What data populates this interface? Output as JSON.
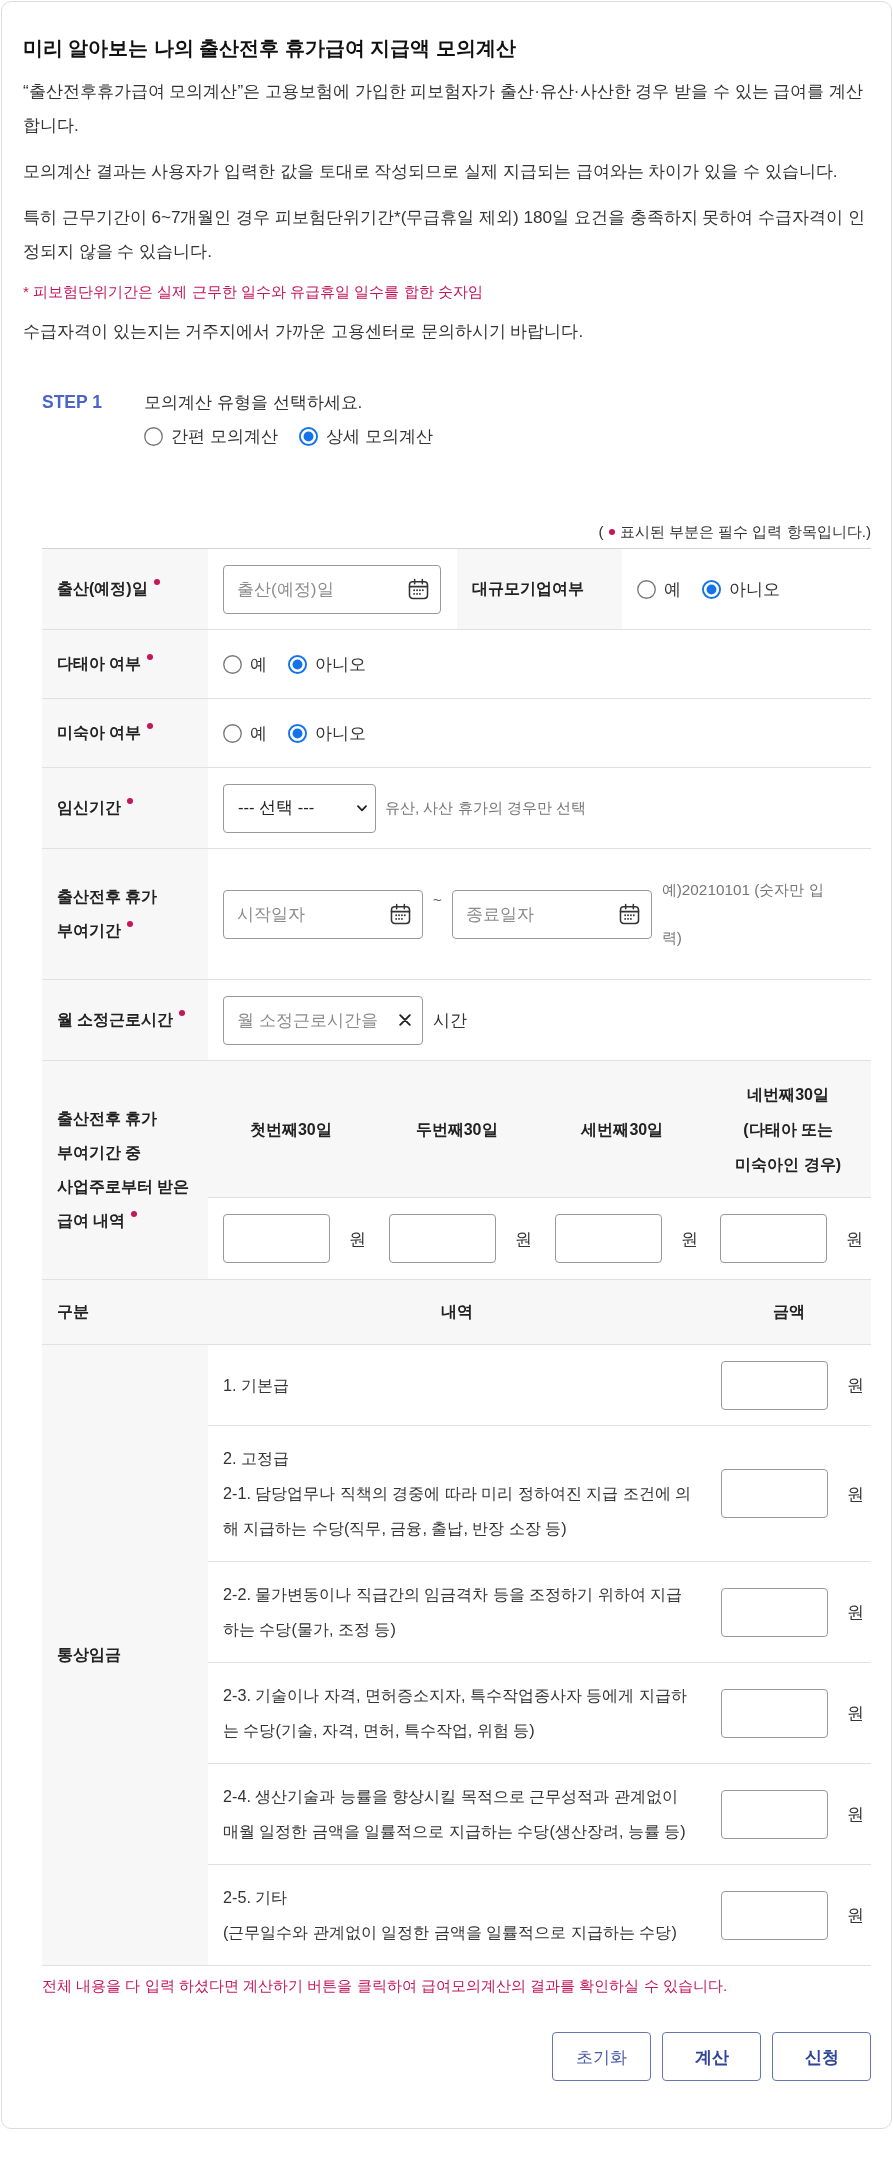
{
  "title": "미리 알아보는 나의 출산전후 휴가급여 지급액 모의계산",
  "intro": [
    {
      "kind": "text",
      "text": "“출산전후휴가급여 모의계산”은 고용보험에 가입한 피보험자가 출산·유산·사산한 경우 받을 수 있는 급여를 계산합니다."
    },
    {
      "kind": "text",
      "text": "모의계산 결과는 사용자가 입력한 값을 토대로 작성되므로 실제 지급되는 급여와는 차이가 있을 수 있습니다."
    },
    {
      "kind": "text",
      "text": "특히 근무기간이 6~7개월인 경우 피보험단위기간*(무급휴일 제외) 180일 요건을 충족하지 못하여 수급자격이 인정되지 않을 수 있습니다."
    },
    {
      "kind": "note",
      "text": "* 피보험단위기간은 실제 근무한 일수와 유급휴일 일수를 합한 숫자임"
    },
    {
      "kind": "text",
      "text": "수급자격이 있는지는 거주지에서 가까운 고용센터로 문의하시기 바랍니다."
    }
  ],
  "step": {
    "label": "STEP 1",
    "prompt": "모의계산 유형을 선택하세요.",
    "options": [
      {
        "label": "간편 모의계산",
        "selected": false
      },
      {
        "label": "상세 모의계산",
        "selected": true
      }
    ]
  },
  "required_note": {
    "open": "(",
    "text": "표시된 부분은 필수 입력 항목입니다.)"
  },
  "form_rows": [
    {
      "kind": "date",
      "label": "출산(예정)일",
      "required": true,
      "placeholder": "출산(예정)일",
      "side": {
        "label": "대규모기업여부",
        "options": [
          {
            "label": "예",
            "selected": false
          },
          {
            "label": "아니오",
            "selected": true
          }
        ]
      }
    },
    {
      "kind": "radio",
      "label": "다태아 여부",
      "required": true,
      "options": [
        {
          "label": "예",
          "selected": false
        },
        {
          "label": "아니오",
          "selected": true
        }
      ]
    },
    {
      "kind": "radio",
      "label": "미숙아 여부",
      "required": true,
      "options": [
        {
          "label": "예",
          "selected": false
        },
        {
          "label": "아니오",
          "selected": true
        }
      ]
    },
    {
      "kind": "select",
      "label": "임신기간",
      "required": true,
      "value": "--- 선택 ---",
      "hint": "유산, 사산 휴가의 경우만 선택"
    },
    {
      "kind": "date_range",
      "label": "출산전후 휴가 부여기간",
      "required": true,
      "start_placeholder": "시작일자",
      "separator": "~",
      "end_placeholder": "종료일자",
      "hint": "예)20210101 (숫자만 입력)"
    },
    {
      "kind": "hours",
      "label": "월 소정근로시간",
      "required": true,
      "placeholder": "월 소정근로시간을",
      "unit": "시간"
    },
    {
      "kind": "monthly_pay",
      "label": "출산전후 휴가 부여기간 중 사업주로부터 받은 급여 내역",
      "required": true,
      "columns": [
        {
          "label": "첫번째30일",
          "unit": "원"
        },
        {
          "label": "두번째30일",
          "unit": "원"
        },
        {
          "label": "세번째30일",
          "unit": "원"
        },
        {
          "label": "네번째30일 (다태아 또는 미숙아인 경우)",
          "unit": "원"
        }
      ]
    }
  ],
  "pay_table": {
    "columns": [
      "구분",
      "내역",
      "금액"
    ],
    "group_label": "통상임금",
    "rows": [
      {
        "lines": [
          "1. 기본급"
        ],
        "unit": "원"
      },
      {
        "lines": [
          "2. 고정급",
          "2-1. 담당업무나 직책의 경중에 따라 미리 정하여진 지급 조건에 의해 지급하는 수당(직무, 금융, 출납, 반장 소장 등)"
        ],
        "unit": "원"
      },
      {
        "lines": [
          "2-2. 물가변동이나 직급간의 임금격차 등을 조정하기 위하여 지급하는 수당(물가, 조정 등)"
        ],
        "unit": "원"
      },
      {
        "lines": [
          "2-3. 기술이나 자격, 면허증소지자, 특수작업종사자 등에게 지급하는 수당(기술, 자격, 면허, 특수작업, 위험 등)"
        ],
        "unit": "원"
      },
      {
        "lines": [
          "2-4. 생산기술과 능률을 향상시킬 목적으로 근무성적과 관계없이 매월 일정한 금액을 일률적으로 지급하는 수당(생산장려, 능률 등)"
        ],
        "unit": "원"
      },
      {
        "lines": [
          "2-5. 기타",
          "(근무일수와 관계없이 일정한 금액을 일률적으로 지급하는 수당)"
        ],
        "unit": "원"
      }
    ]
  },
  "footer_note": "전체 내용을 다 입력 하셨다면 계산하기 버튼을 클릭하여 급여모의계산의 결과를 확인하실 수 있습니다.",
  "buttons": [
    {
      "label": "초기화",
      "kind": "secondary"
    },
    {
      "label": "계산",
      "kind": "primary"
    },
    {
      "label": "신청",
      "kind": "primary"
    }
  ]
}
